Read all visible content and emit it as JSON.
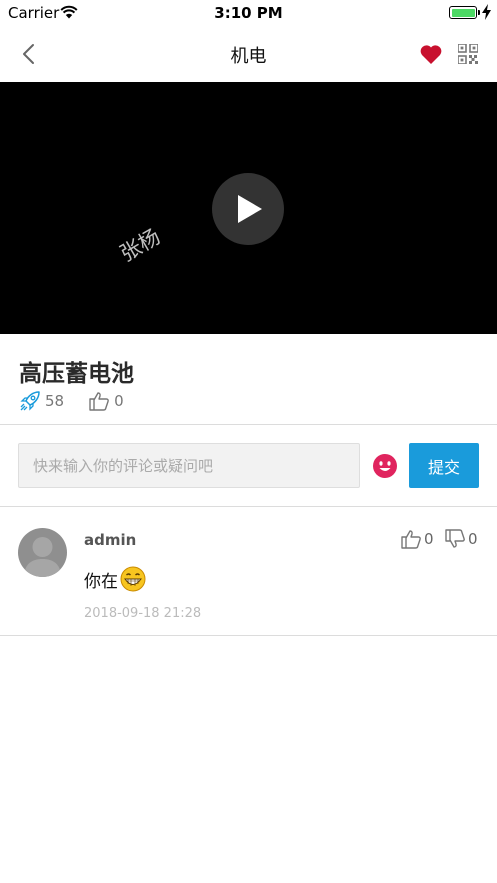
{
  "status_bar": {
    "carrier": "Carrier",
    "time": "3:10 PM",
    "battery_color": "#4cd964"
  },
  "nav": {
    "title": "机电",
    "back_icon": "chevron-left-icon",
    "favorite_icon": "heart-icon",
    "favorite_color": "#c8102e",
    "qr_icon": "qr-code-icon"
  },
  "video": {
    "watermark": "张杨",
    "play_icon": "play-icon"
  },
  "course": {
    "title": "高压蓄电池",
    "views": "58",
    "likes": "0"
  },
  "comment_form": {
    "placeholder": "快来输入你的评论或疑问吧",
    "emoji_icon": "emoji-face-icon",
    "submit_label": "提交",
    "accent": "#1a9bdb"
  },
  "comments": [
    {
      "user": "admin",
      "text": "你在",
      "emoji": "grinning-emoji",
      "time": "2018-09-18 21:28",
      "likes": "0",
      "dislikes": "0"
    }
  ]
}
